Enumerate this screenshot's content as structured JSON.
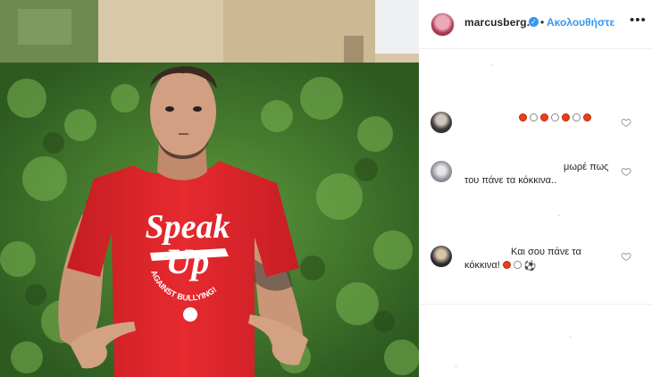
{
  "header": {
    "username": "marcusberg.9",
    "verified_mark": "✓",
    "separator": "•",
    "follow_label": "Ακολουθήστε",
    "more_label": "•••"
  },
  "photo": {
    "shirt_line1": "Speak",
    "shirt_line2": "Up",
    "shirt_arc": "AGAINST BULLYING!"
  },
  "comments": [
    {
      "text": "",
      "emoji": [
        "red",
        "white",
        "red",
        "white",
        "red",
        "white",
        "red"
      ]
    },
    {
      "text_line1": "μωρέ πως",
      "text_line2": "του πάνε τα κόκκινα.."
    },
    {
      "text_line1": "Και σου πάνε τα",
      "text_line2": "κόκκινα!",
      "emoji": [
        "red",
        "white"
      ],
      "extra_icon": "soccer-ball-icon"
    }
  ],
  "icons": {
    "like": "heart-outline-icon",
    "more": "more-dots-icon"
  },
  "colors": {
    "accent": "#3897f0",
    "text": "#262626",
    "shirt": "#e0262c"
  }
}
